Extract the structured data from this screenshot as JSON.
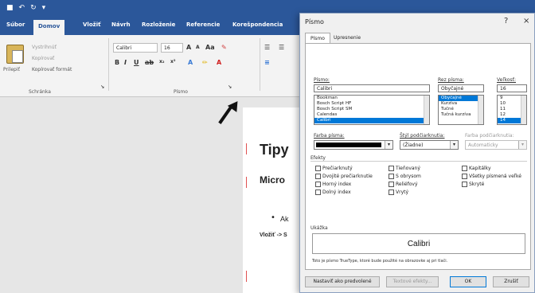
{
  "word": {
    "tabs": [
      "Súbor",
      "Domov",
      "Vložiť",
      "Návrh",
      "Rozloženie",
      "Referencie",
      "Korešpondencia"
    ],
    "active_tab": "Domov",
    "clipboard": {
      "paste": "Prilepiť",
      "cut": "Vystrihnúť",
      "copy": "Kopírovať",
      "format_painter": "Kopírovať formát",
      "group": "Schránka"
    },
    "font": {
      "name": "Calibri",
      "size": "16",
      "group": "Písmo"
    },
    "document": {
      "heading": "Tipy",
      "subheading": "Micro",
      "bullet": "Ak",
      "line": "Vložiť -> S"
    }
  },
  "dialog": {
    "title": "Písmo",
    "help": "?",
    "close": "×",
    "tabs": [
      "Písmo",
      "Upresnenie"
    ],
    "font_label": "Písmo:",
    "font_value": "Calibri",
    "font_list": [
      "Bookman",
      "Bosch Script HF",
      "Bosch Script SM",
      "Calendas",
      "Calibri"
    ],
    "style_label": "Rez písma:",
    "style_value": "Obyčajné",
    "style_list": [
      "Obyčajné",
      "Kurzíva",
      "Tučné",
      "Tučná kurzíva"
    ],
    "size_label": "Veľkosť:",
    "size_value": "16",
    "size_list": [
      "9",
      "10",
      "11",
      "12",
      "14"
    ],
    "color_label": "Farba písma:",
    "underline_label": "Štýl podčiarknutia:",
    "underline_value": "(Žiadne)",
    "underline_color_label": "Farba podčiarknutia:",
    "underline_color_value": "Automaticky",
    "effects_label": "Efekty",
    "effects": [
      "Prečiarknutý",
      "Dvojité prečiarknutie",
      "Horný index",
      "Dolný index",
      "Tieňovaný",
      "S obrysom",
      "Reliéfový",
      "Vrytý",
      "Kapitálky",
      "Všetky písmená veľké",
      "Skryté"
    ],
    "preview_label": "Ukážka",
    "preview_text": "Calibri",
    "note": "Toto je písmo TrueType, ktoré bude použité na obrazovke aj pri tlači.",
    "buttons": {
      "default": "Nastaviť ako predvolené",
      "text_effects": "Textové efekty...",
      "ok": "OK",
      "cancel": "Zrušiť"
    }
  }
}
